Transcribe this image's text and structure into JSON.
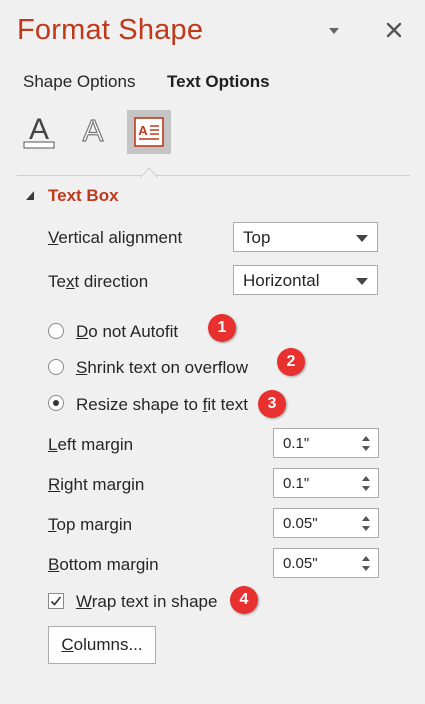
{
  "header": {
    "title": "Format Shape"
  },
  "tabs": [
    {
      "label": "Shape Options",
      "active": false
    },
    {
      "label": "Text Options",
      "active": true
    }
  ],
  "category_icons": [
    "text-fill-outline-icon",
    "text-effects-icon",
    "textbox-icon"
  ],
  "section": {
    "title": "Text Box",
    "expanded": true
  },
  "vertical_alignment": {
    "label_u": "V",
    "label_rest": "ertical alignment",
    "value": "Top"
  },
  "text_direction": {
    "label_pre": "Te",
    "label_u": "x",
    "label_post": "t direction",
    "value": "Horizontal"
  },
  "autofit": [
    {
      "label_u": "D",
      "label_rest": "o not Autofit",
      "selected": false,
      "badge": "1"
    },
    {
      "label_u": "S",
      "label_rest": "hrink text on overflow",
      "selected": false,
      "badge": "2"
    },
    {
      "label_pre": "Resize shape to ",
      "label_u": "f",
      "label_rest": "it text",
      "selected": true,
      "badge": "3"
    }
  ],
  "margins": [
    {
      "label_u": "L",
      "label_rest": "eft margin",
      "value": "0.1\""
    },
    {
      "label_u": "R",
      "label_rest": "ight margin",
      "value": "0.1\""
    },
    {
      "label_u": "T",
      "label_rest": "op margin",
      "value": "0.05\""
    },
    {
      "label_u": "B",
      "label_rest": "ottom margin",
      "value": "0.05\""
    }
  ],
  "wrap": {
    "label_u": "W",
    "label_rest": "rap text in shape",
    "checked": true,
    "badge": "4"
  },
  "columns_button": {
    "label_u": "C",
    "label_rest": "olumns..."
  },
  "colors": {
    "accent": "#c0391b",
    "badge": "#e8302f",
    "panel_bg": "#f0f0f0"
  }
}
